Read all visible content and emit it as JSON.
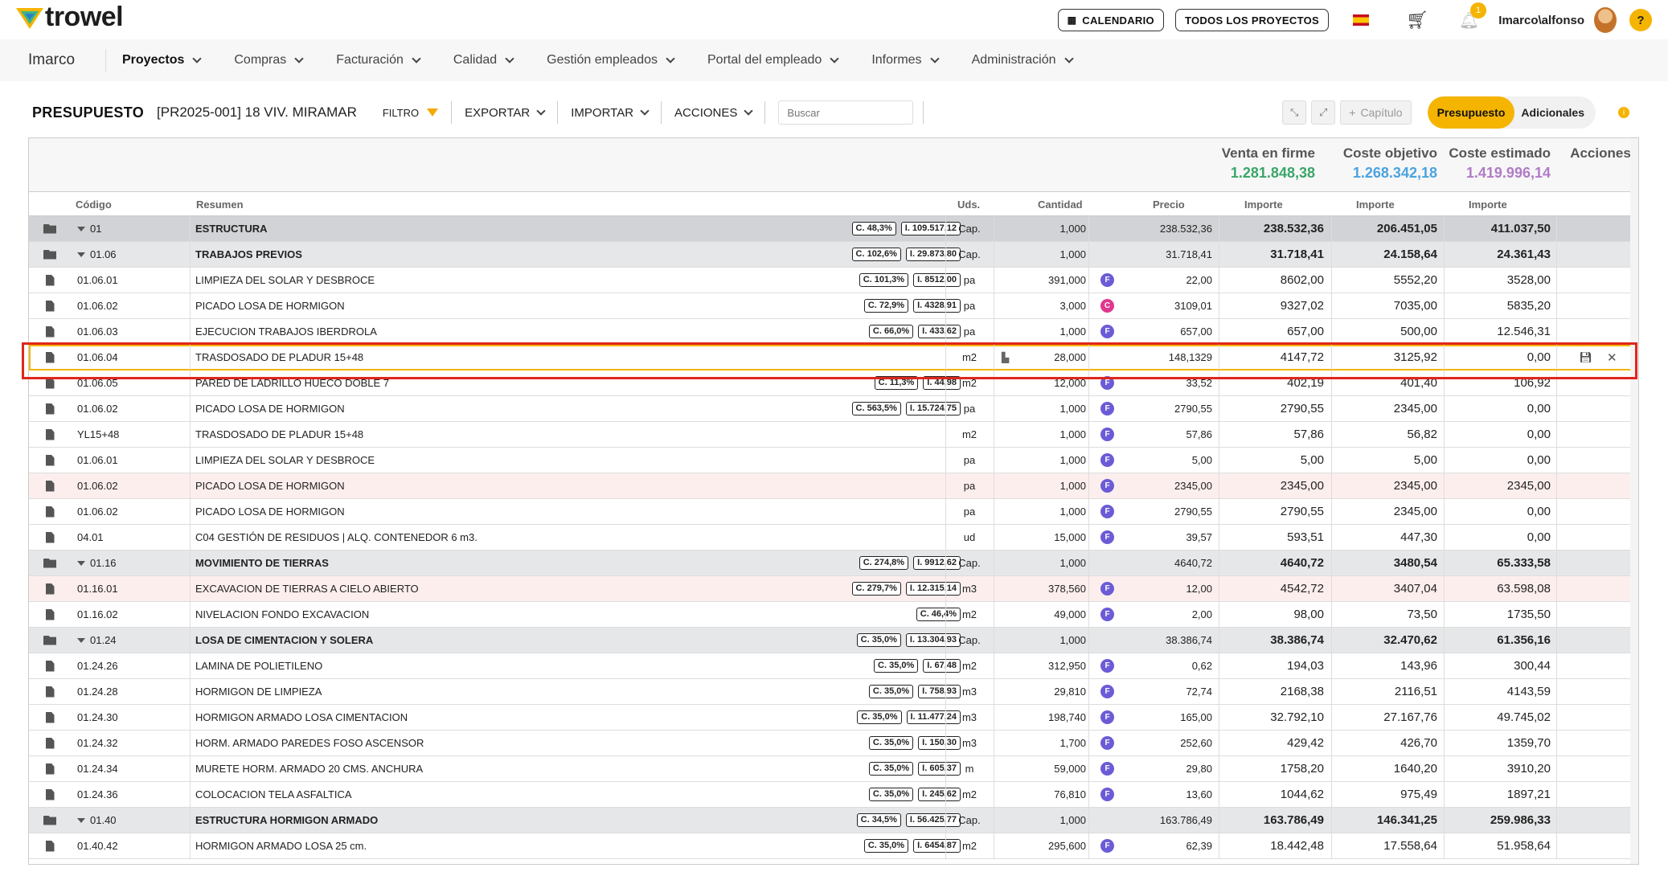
{
  "app": {
    "logo_text": "trowel",
    "buttons": {
      "calendar": "CALENDARIO",
      "all_projects": "TODOS LOS PROYECTOS"
    },
    "notif_count": "1",
    "user": "Imarco\\alfonso",
    "help": "?"
  },
  "nav": {
    "brand": "Imarco",
    "items": [
      "Proyectos",
      "Compras",
      "Facturación",
      "Calidad",
      "Gestión empleados",
      "Portal del empleado",
      "Informes",
      "Administración"
    ]
  },
  "toolbar": {
    "title": "PRESUPUESTO",
    "project": "[PR2025-001] 18 VIV. MIRAMAR",
    "filter": "FILTRO",
    "export": "EXPORTAR",
    "import": "IMPORTAR",
    "actions": "ACCIONES",
    "search_placeholder": "Buscar",
    "chapter": "Capítulo",
    "tab_budget": "Presupuesto",
    "tab_additional": "Adicionales"
  },
  "summary": {
    "venta": {
      "label": "Venta en firme",
      "value": "1.281.848,38",
      "color": "#3aa66a"
    },
    "objetivo": {
      "label": "Coste objetivo",
      "value": "1.268.342,18",
      "color": "#4aa3df"
    },
    "estimado": {
      "label": "Coste estimado",
      "value": "1.419.996,14",
      "color": "#b07cc6"
    },
    "acciones": "Acciones"
  },
  "headers": {
    "codigo": "Código",
    "resumen": "Resumen",
    "uds": "Uds.",
    "cantidad": "Cantidad",
    "precio": "Precio",
    "importe1": "Importe",
    "importe2": "Importe",
    "importe3": "Importe"
  },
  "rows": [
    {
      "type": "cap1",
      "code": "01",
      "res": "ESTRUCTURA",
      "tags": [
        "C. 48,3%",
        "I. 109.517,12"
      ],
      "uds": "Cap.",
      "cant": "1,000",
      "prec": "238.532,36",
      "b": "",
      "i1": "238.532,36",
      "i2": "206.451,05",
      "i3": "411.037,50"
    },
    {
      "type": "cap2",
      "code": "01.06",
      "res": "TRABAJOS PREVIOS",
      "tags": [
        "C. 102,6%",
        "I. 29.873,80"
      ],
      "uds": "Cap.",
      "cant": "1,000",
      "prec": "31.718,41",
      "b": "",
      "i1": "31.718,41",
      "i2": "24.158,64",
      "i3": "24.361,43"
    },
    {
      "type": "item",
      "code": "01.06.01",
      "res": "LIMPIEZA DEL SOLAR Y DESBROCE",
      "tags": [
        "C. 101,3%",
        "I. 8512,00"
      ],
      "uds": "pa",
      "cant": "391,000",
      "prec": "22,00",
      "b": "F",
      "i1": "8602,00",
      "i2": "5552,20",
      "i3": "3528,00"
    },
    {
      "type": "item",
      "code": "01.06.02",
      "res": "PICADO LOSA DE HORMIGON",
      "tags": [
        "C. 72,9%",
        "I. 4328,91"
      ],
      "uds": "pa",
      "cant": "3,000",
      "prec": "3109,01",
      "b": "C",
      "i1": "9327,02",
      "i2": "7035,00",
      "i3": "5835,20"
    },
    {
      "type": "item",
      "code": "01.06.03",
      "res": "EJECUCION TRABAJOS IBERDROLA",
      "tags": [
        "C. 66,0%",
        "I. 433,62"
      ],
      "uds": "pa",
      "cant": "1,000",
      "prec": "657,00",
      "b": "F",
      "i1": "657,00",
      "i2": "500,00",
      "i3": "12.546,31"
    },
    {
      "type": "sel",
      "code": "01.06.04",
      "res": "TRASDOSADO DE PLADUR 15+48",
      "tags": [],
      "uds": "m2",
      "cant": "28,000",
      "prec": "148,1329",
      "b": "",
      "i1": "4147,72",
      "i2": "3125,92",
      "i3": "0,00"
    },
    {
      "type": "item",
      "code": "01.06.05",
      "res": "PARED DE LADRILLO HUECO DOBLE 7",
      "tags": [
        "C. 11,3%",
        "I. 44,98"
      ],
      "uds": "m2",
      "cant": "12,000",
      "prec": "33,52",
      "b": "F",
      "i1": "402,19",
      "i2": "401,40",
      "i3": "106,92"
    },
    {
      "type": "item",
      "code": "01.06.02",
      "res": "PICADO LOSA DE HORMIGON",
      "tags": [
        "C. 563,5%",
        "I. 15.724,75"
      ],
      "uds": "pa",
      "cant": "1,000",
      "prec": "2790,55",
      "b": "F",
      "i1": "2790,55",
      "i2": "2345,00",
      "i3": "0,00"
    },
    {
      "type": "item",
      "code": "YL15+48",
      "res": "TRASDOSADO DE PLADUR 15+48",
      "tags": [],
      "uds": "m2",
      "cant": "1,000",
      "prec": "57,86",
      "b": "F",
      "i1": "57,86",
      "i2": "56,82",
      "i3": "0,00"
    },
    {
      "type": "item",
      "code": "01.06.01",
      "res": "LIMPIEZA DEL SOLAR Y DESBROCE",
      "tags": [],
      "uds": "pa",
      "cant": "1,000",
      "prec": "5,00",
      "b": "F",
      "i1": "5,00",
      "i2": "5,00",
      "i3": "0,00"
    },
    {
      "type": "pink",
      "code": "01.06.02",
      "res": "PICADO LOSA DE HORMIGON",
      "tags": [],
      "uds": "pa",
      "cant": "1,000",
      "prec": "2345,00",
      "b": "F",
      "i1": "2345,00",
      "i2": "2345,00",
      "i3": "2345,00"
    },
    {
      "type": "item",
      "code": "01.06.02",
      "res": "PICADO LOSA DE HORMIGON",
      "tags": [],
      "uds": "pa",
      "cant": "1,000",
      "prec": "2790,55",
      "b": "F",
      "i1": "2790,55",
      "i2": "2345,00",
      "i3": "0,00"
    },
    {
      "type": "item",
      "code": "04.01",
      "res": "C04 GESTIÓN DE RESIDUOS | ALQ. CONTENEDOR 6 m3.",
      "tags": [],
      "uds": "ud",
      "cant": "15,000",
      "prec": "39,57",
      "b": "F",
      "i1": "593,51",
      "i2": "447,30",
      "i3": "0,00"
    },
    {
      "type": "cap2",
      "code": "01.16",
      "res": "MOVIMIENTO DE TIERRAS",
      "tags": [
        "C. 274,8%",
        "I. 9912,62"
      ],
      "uds": "Cap.",
      "cant": "1,000",
      "prec": "4640,72",
      "b": "",
      "i1": "4640,72",
      "i2": "3480,54",
      "i3": "65.333,58"
    },
    {
      "type": "pink",
      "code": "01.16.01",
      "res": "EXCAVACION DE TIERRAS A CIELO ABIERTO",
      "tags": [
        "C. 279,7%",
        "I. 12.315,14"
      ],
      "uds": "m3",
      "cant": "378,560",
      "prec": "12,00",
      "b": "F",
      "i1": "4542,72",
      "i2": "3407,04",
      "i3": "63.598,08"
    },
    {
      "type": "item",
      "code": "01.16.02",
      "res": "NIVELACION FONDO EXCAVACION",
      "tags": [
        "C. 46,4%"
      ],
      "uds": "m2",
      "cant": "49,000",
      "prec": "2,00",
      "b": "F",
      "i1": "98,00",
      "i2": "73,50",
      "i3": "1735,50"
    },
    {
      "type": "cap2",
      "code": "01.24",
      "res": "LOSA DE CIMENTACION Y SOLERA",
      "tags": [
        "C. 35,0%",
        "I. 13.304,93"
      ],
      "uds": "Cap.",
      "cant": "1,000",
      "prec": "38.386,74",
      "b": "",
      "i1": "38.386,74",
      "i2": "32.470,62",
      "i3": "61.356,16"
    },
    {
      "type": "item",
      "code": "01.24.26",
      "res": "LAMINA DE POLIETILENO",
      "tags": [
        "C. 35,0%",
        "I. 67,48"
      ],
      "uds": "m2",
      "cant": "312,950",
      "prec": "0,62",
      "b": "F",
      "i1": "194,03",
      "i2": "143,96",
      "i3": "300,44"
    },
    {
      "type": "item",
      "code": "01.24.28",
      "res": "HORMIGON DE LIMPIEZA",
      "tags": [
        "C. 35,0%",
        "I. 758,93"
      ],
      "uds": "m3",
      "cant": "29,810",
      "prec": "72,74",
      "b": "F",
      "i1": "2168,38",
      "i2": "2116,51",
      "i3": "4143,59"
    },
    {
      "type": "item",
      "code": "01.24.30",
      "res": "HORMIGON ARMADO LOSA CIMENTACION",
      "tags": [
        "C. 35,0%",
        "I. 11.477,24"
      ],
      "uds": "m3",
      "cant": "198,740",
      "prec": "165,00",
      "b": "F",
      "i1": "32.792,10",
      "i2": "27.167,76",
      "i3": "49.745,02"
    },
    {
      "type": "item",
      "code": "01.24.32",
      "res": "HORM. ARMADO PAREDES FOSO ASCENSOR",
      "tags": [
        "C. 35,0%",
        "I. 150,30"
      ],
      "uds": "m3",
      "cant": "1,700",
      "prec": "252,60",
      "b": "F",
      "i1": "429,42",
      "i2": "426,70",
      "i3": "1359,70"
    },
    {
      "type": "item",
      "code": "01.24.34",
      "res": "MURETE HORM. ARMADO 20 CMS. ANCHURA",
      "tags": [
        "C. 35,0%",
        "I. 605,37"
      ],
      "uds": "m",
      "cant": "59,000",
      "prec": "29,80",
      "b": "F",
      "i1": "1758,20",
      "i2": "1640,20",
      "i3": "3910,20"
    },
    {
      "type": "item",
      "code": "01.24.36",
      "res": "COLOCACION TELA ASFALTICA",
      "tags": [
        "C. 35,0%",
        "I. 245,62"
      ],
      "uds": "m2",
      "cant": "76,810",
      "prec": "13,60",
      "b": "F",
      "i1": "1044,62",
      "i2": "975,49",
      "i3": "1897,21"
    },
    {
      "type": "cap2",
      "code": "01.40",
      "res": "ESTRUCTURA HORMIGON ARMADO",
      "tags": [
        "C. 34,5%",
        "I. 56.425,77"
      ],
      "uds": "Cap.",
      "cant": "1,000",
      "prec": "163.786,49",
      "b": "",
      "i1": "163.786,49",
      "i2": "146.341,25",
      "i3": "259.986,33"
    },
    {
      "type": "item",
      "code": "01.40.42",
      "res": "HORMIGON ARMADO LOSA 25 cm.",
      "tags": [
        "C. 35,0%",
        "I. 6454,87"
      ],
      "uds": "m2",
      "cant": "295,600",
      "prec": "62,39",
      "b": "F",
      "i1": "18.442,48",
      "i2": "17.558,64",
      "i3": "51.958,64"
    }
  ]
}
